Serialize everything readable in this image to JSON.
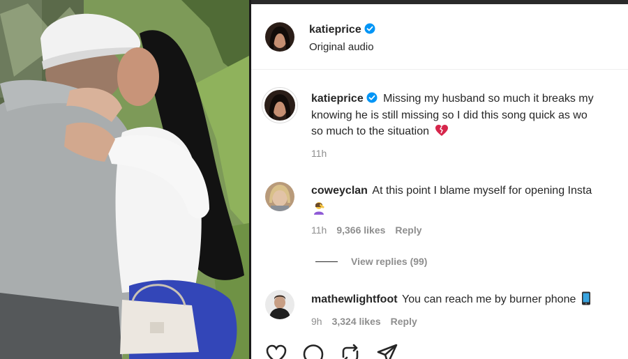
{
  "post": {
    "author": {
      "username": "katieprice",
      "verified": true,
      "audio_label": "Original audio"
    },
    "caption": {
      "username": "katieprice",
      "lines": [
        "Missing my husband so much it breaks my",
        "knowing he is still missing so I did this song quick as wo",
        "so much to the situation"
      ],
      "emoji": "broken-heart-icon",
      "time": "11h"
    }
  },
  "comments": [
    {
      "username": "coweyclan",
      "lines": [
        "At this point I blame myself for opening Insta"
      ],
      "emoji_line": "woman-facepalming-icon",
      "time": "11h",
      "likes": "9,366 likes",
      "reply_label": "Reply",
      "view_replies": "View replies (99)"
    },
    {
      "username": "mathewlightfoot",
      "lines": [
        "You can reach me by burner phone"
      ],
      "emoji": "mobile-phone-icon",
      "time": "9h",
      "likes": "3,324 likes",
      "reply_label": "Reply"
    }
  ],
  "actions": [
    "heart-icon",
    "comment-icon",
    "repost-icon",
    "share-icon"
  ],
  "colors": {
    "text": "#262626",
    "muted": "#8e8e8e",
    "verified_badge": "#0095f6",
    "heart": "#d6264b"
  }
}
